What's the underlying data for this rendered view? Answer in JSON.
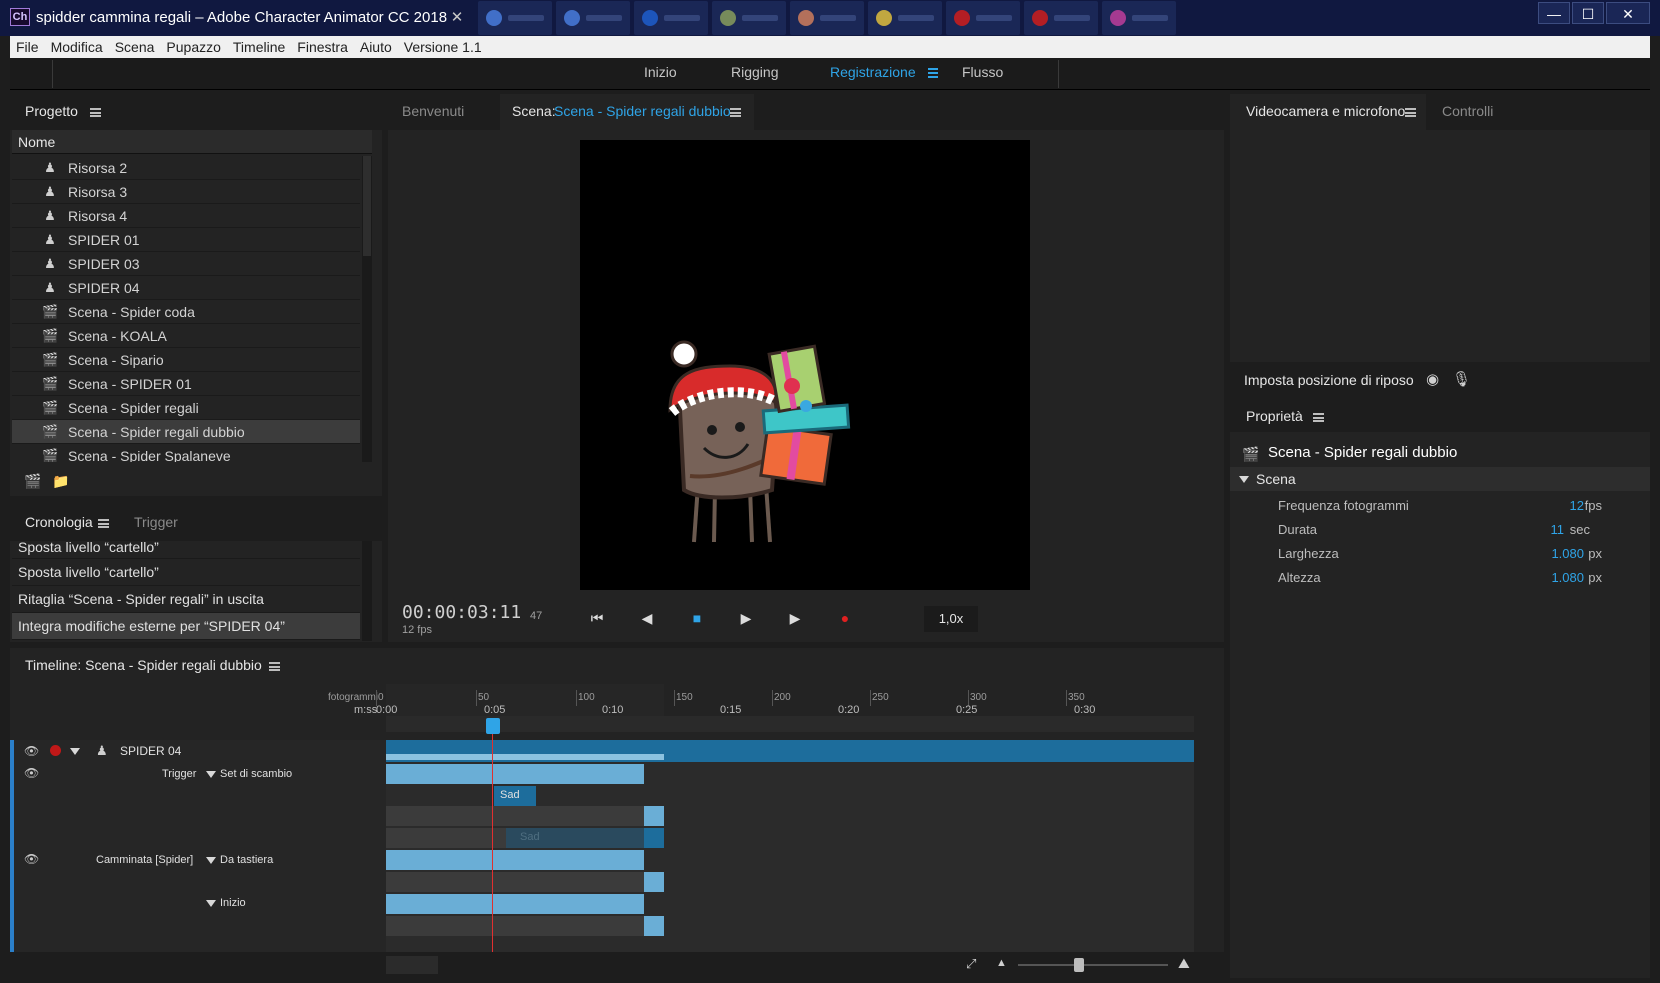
{
  "window": {
    "title": "spidder cammina regali – Adobe Character Animator CC 2018",
    "logo": "Ch",
    "close_tab": "✕",
    "controls": {
      "minimize": "—",
      "maximize": "☐",
      "close": "✕"
    }
  },
  "menubar": [
    "File",
    "Modifica",
    "Scena",
    "Pupazzo",
    "Timeline",
    "Finestra",
    "Aiuto",
    "Versione 1.1"
  ],
  "workspaces": {
    "tabs": [
      "Inizio",
      "Rigging",
      "Registrazione",
      "Flusso"
    ],
    "active": "Registrazione"
  },
  "project": {
    "title": "Progetto",
    "column_name": "Nome",
    "items": [
      {
        "label": "Risorsa 2",
        "type": "puppet"
      },
      {
        "label": "Risorsa 3",
        "type": "puppet"
      },
      {
        "label": "Risorsa 4",
        "type": "puppet"
      },
      {
        "label": "SPIDER 01",
        "type": "puppet"
      },
      {
        "label": "SPIDER 03",
        "type": "puppet"
      },
      {
        "label": "SPIDER 04",
        "type": "puppet"
      },
      {
        "label": "Scena -  Spider coda",
        "type": "scene"
      },
      {
        "label": "Scena - KOALA",
        "type": "scene"
      },
      {
        "label": "Scena - Sipario",
        "type": "scene"
      },
      {
        "label": "Scena - SPIDER 01",
        "type": "scene"
      },
      {
        "label": "Scena - Spider regali",
        "type": "scene"
      },
      {
        "label": "Scena - Spider regali dubbio",
        "type": "scene",
        "selected": true
      },
      {
        "label": "Scena - Spider Spalaneve",
        "type": "scene"
      }
    ]
  },
  "history": {
    "title": "Cronologia",
    "tab_trigger": "Trigger",
    "items": [
      {
        "label": "Sposta livello “cartello”"
      },
      {
        "label": "Sposta livello “cartello”"
      },
      {
        "label": "Ritaglia “Scena - Spider regali” in uscita"
      },
      {
        "label": "Integra modifiche esterne per “SPIDER 04”",
        "selected": true
      }
    ]
  },
  "scene": {
    "tab_welcome": "Benvenuti",
    "tab_scene_prefix": "Scena:",
    "tab_scene_name": "Scena - Spider regali dubbio",
    "time": "00:00:03:11",
    "fps": "12 fps",
    "frame": "47",
    "zoom": "1,0x"
  },
  "camera": {
    "title": "Videocamera e microfono",
    "tab_controls": "Controlli",
    "rest_pose": "Imposta posizione di riposo"
  },
  "properties": {
    "title": "Proprietà",
    "object": "Scena - Spider regali dubbio",
    "group": "Scena",
    "rows": [
      {
        "label": "Frequenza fotogrammi",
        "value": "12",
        "unit": "fps"
      },
      {
        "label": "Durata",
        "value": "11",
        "unit": "sec"
      },
      {
        "label": "Larghezza",
        "value": "1.080",
        "unit": "px"
      },
      {
        "label": "Altezza",
        "value": "1.080",
        "unit": "px"
      }
    ]
  },
  "timeline": {
    "title": "Timeline: Scena - Spider regali dubbio",
    "ruler_frames_label": "fotogrammi",
    "ruler_time_label": "m:ss",
    "frame_ticks": [
      "0",
      "50",
      "100",
      "150",
      "200",
      "250",
      "300",
      "350"
    ],
    "time_ticks": [
      "0:00",
      "0:05",
      "0:10",
      "0:15",
      "0:20",
      "0:25",
      "0:30"
    ],
    "track_puppet": "SPIDER 04",
    "trigger_label": "Trigger",
    "trigger_value": "Set di scambio",
    "take_sad": "Sad",
    "take_sad_dim": "Sad",
    "walk_label": "Camminata [Spider]",
    "walk_value": "Da tastiera",
    "start_label": "Inizio"
  }
}
